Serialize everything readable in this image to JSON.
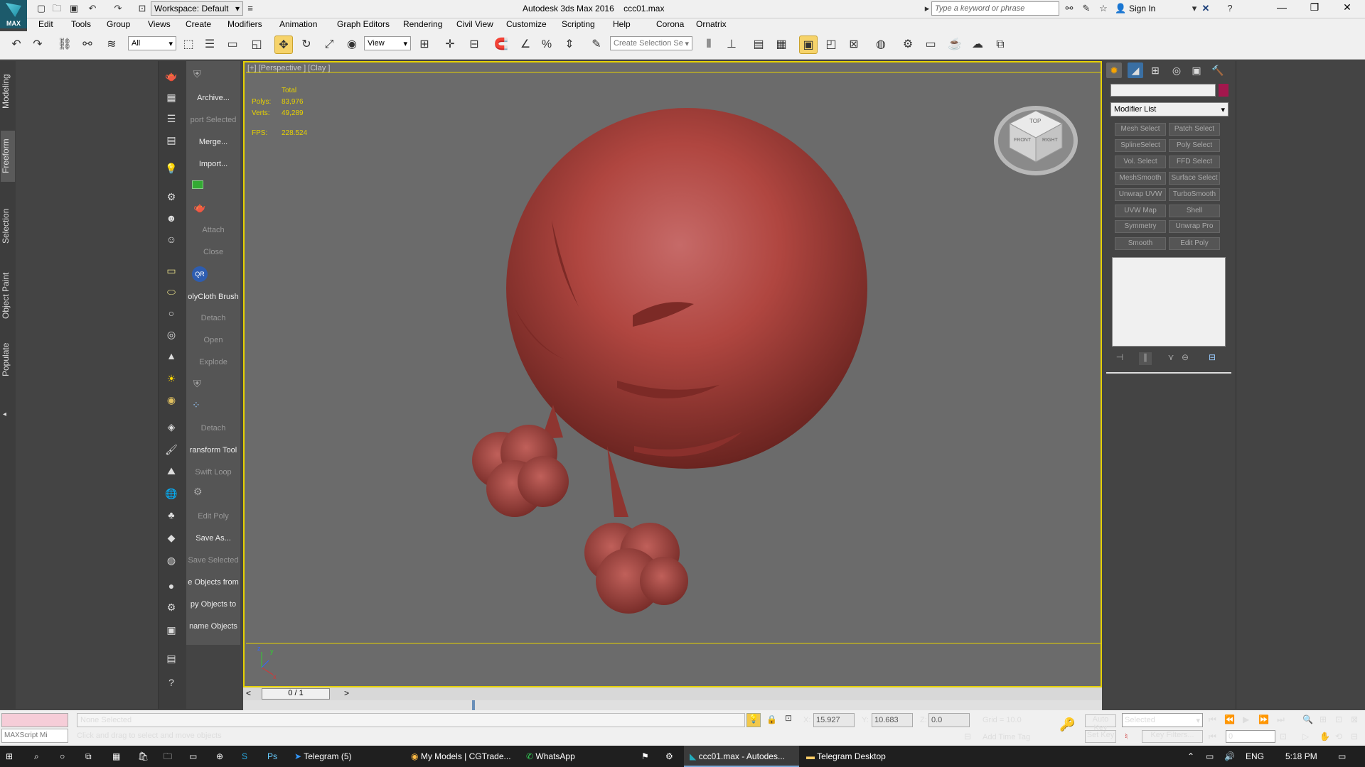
{
  "titlebar": {
    "logo": "MAX",
    "workspace": "Workspace: Default",
    "app_title": "Autodesk 3ds Max 2016",
    "file_name": "ccc01.max",
    "search_placeholder": "Type a keyword or phrase",
    "sign_in": "Sign In"
  },
  "menus": [
    "Edit",
    "Tools",
    "Group",
    "Views",
    "Create",
    "Modifiers",
    "Animation",
    "Graph Editors",
    "Rendering",
    "Civil View",
    "Customize",
    "Scripting",
    "Help",
    "Corona",
    "Ornatrix"
  ],
  "toolbar": {
    "filter": "All",
    "ref_coord": "View",
    "selection_set_placeholder": "Create Selection Se"
  },
  "ribbon_tabs": [
    "Modeling",
    "Freeform",
    "Selection",
    "Object Paint",
    "Populate"
  ],
  "ribbon_active": "Freeform",
  "left_labels": [
    {
      "text": "Archive...",
      "enabled": true
    },
    {
      "text": "port Selected",
      "enabled": false
    },
    {
      "text": "Merge...",
      "enabled": true
    },
    {
      "text": "Import...",
      "enabled": true
    },
    {
      "text": "",
      "enabled": true
    },
    {
      "text": "",
      "enabled": false
    },
    {
      "text": "Attach",
      "enabled": false
    },
    {
      "text": "Close",
      "enabled": false
    },
    {
      "text": "",
      "enabled": true
    },
    {
      "text": "olyCloth Brush",
      "enabled": true
    },
    {
      "text": "Detach",
      "enabled": false
    },
    {
      "text": "Open",
      "enabled": false
    },
    {
      "text": "Explode",
      "enabled": false
    },
    {
      "text": "",
      "enabled": false
    },
    {
      "text": "",
      "enabled": true
    },
    {
      "text": "Detach",
      "enabled": false
    },
    {
      "text": "ransform Tool",
      "enabled": true
    },
    {
      "text": "Swift Loop",
      "enabled": false
    },
    {
      "text": "",
      "enabled": false
    },
    {
      "text": "Edit Poly",
      "enabled": false
    },
    {
      "text": "Save As...",
      "enabled": true
    },
    {
      "text": "Save Selected",
      "enabled": false
    },
    {
      "text": "e Objects from",
      "enabled": true
    },
    {
      "text": "py Objects to",
      "enabled": true
    },
    {
      "text": "name Objects",
      "enabled": true
    }
  ],
  "viewport": {
    "label": "[+] [Perspective ] [Clay ]",
    "stats_header": "Total",
    "polys_label": "Polys:",
    "polys": "83,976",
    "verts_label": "Verts:",
    "verts": "49,289",
    "fps_label": "FPS:",
    "fps": "228.524",
    "viewcube_top": "TOP",
    "viewcube_front": "FRONT",
    "viewcube_right": "RIGHT"
  },
  "timeline": {
    "frame": "0 / 1"
  },
  "command_panel": {
    "modifier_list": "Modifier List",
    "buttons": [
      "Mesh Select",
      "Patch Select",
      "SplineSelect",
      "Poly Select",
      "Vol. Select",
      "FFD Select",
      "MeshSmooth",
      "Surface Select",
      "Unwrap UVW",
      "TurboSmooth",
      "UVW Map",
      "Shell",
      "Symmetry",
      "Unwrap Pro",
      "Smooth",
      "Edit Poly"
    ],
    "object_color": "#a3174d"
  },
  "status": {
    "maxscript": "MAXScript Mi",
    "selection": "None Selected",
    "prompt": "Click and drag to select and move objects",
    "x_label": "X:",
    "x": "15.927",
    "y_label": "Y:",
    "y": "10.683",
    "z_label": "Z:",
    "z": "0.0",
    "grid": "Grid = 10.0",
    "add_time_tag": "Add Time Tag",
    "auto_key": "Auto Key",
    "set_key": "Set Key",
    "key_mode": "Selected",
    "key_filters": "Key Filters...",
    "frame_field": "0"
  },
  "taskbar": {
    "items": [
      "Telegram (5)",
      "My Models | CGTrade...",
      "WhatsApp",
      "ccc01.max - Autodes...",
      "Telegram Desktop"
    ],
    "lang": "ENG",
    "time": "5:18 PM"
  }
}
